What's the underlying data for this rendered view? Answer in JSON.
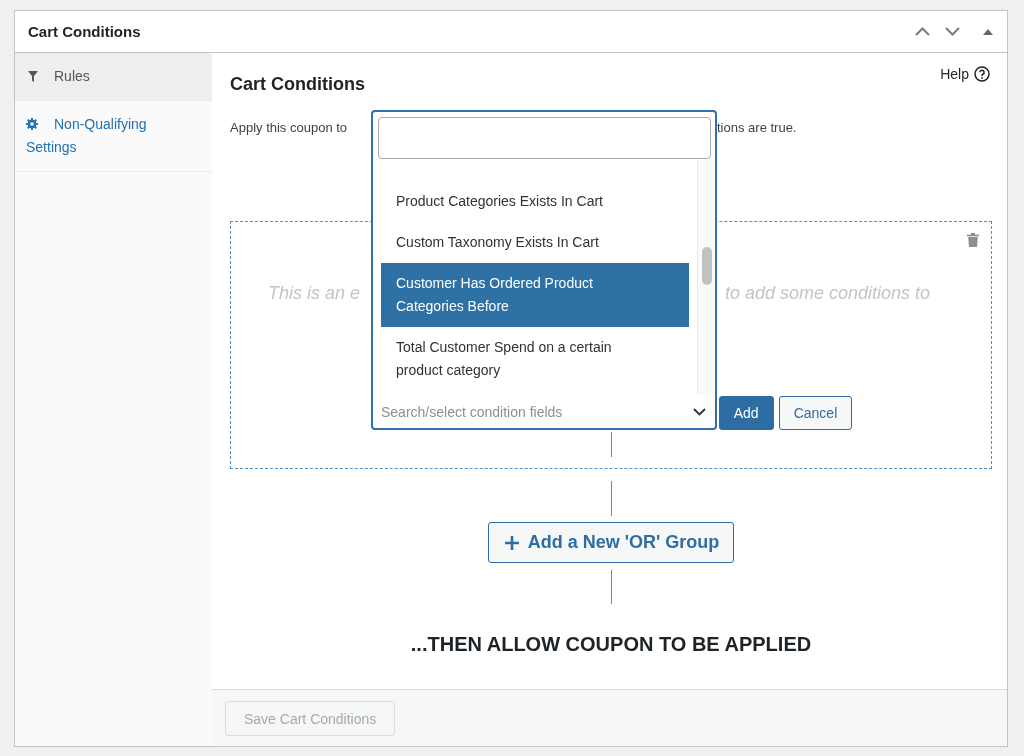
{
  "panel": {
    "title": "Cart Conditions"
  },
  "sidebar": {
    "items": [
      {
        "label": "Rules",
        "selected": true
      },
      {
        "label": "Non-Qualifying Settings",
        "selected": false
      }
    ]
  },
  "section": {
    "title": "Cart Conditions",
    "help_link": "Help",
    "description": {
      "visible_left": "Apply this coupon to",
      "visible_right": "tions are true."
    }
  },
  "condition_group": {
    "empty_message": {
      "visible_left": "This is an e",
      "visible_right": "to add some conditions to"
    },
    "condition_dropdown": {
      "options": [
        {
          "label": "Product Categories Exists In Cart",
          "selected": false
        },
        {
          "label": "Custom Taxonomy Exists In Cart",
          "selected": false
        },
        {
          "label": "Customer Has Ordered Product Categories Before",
          "selected": true
        },
        {
          "label": "Total Customer Spend on a certain product category",
          "selected": false
        }
      ],
      "placeholder": "Search/select condition fields"
    },
    "buttons": [
      {
        "label": "Add",
        "kind": "primary"
      },
      {
        "label": "Cancel",
        "kind": "secondary"
      }
    ]
  },
  "add_group_button": {
    "label": "Add a New 'OR' Group"
  },
  "outcome": "...THEN ALLOW COUPON TO BE APPLIED",
  "footer": {
    "save_button": {
      "label": "Save Cart Conditions",
      "disabled": true
    }
  }
}
